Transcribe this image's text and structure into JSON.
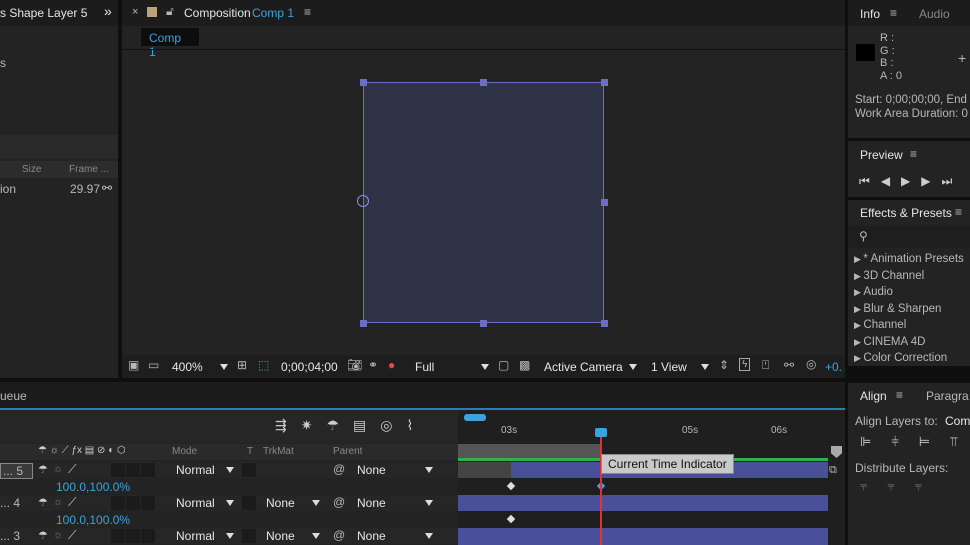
{
  "project_panel": {
    "title": "s Shape Layer 5",
    "more": "»",
    "item_label": "s",
    "columns": [
      "Size",
      "Frame ..."
    ],
    "row": {
      "name": "ion",
      "frame_rate": "29.97"
    }
  },
  "comp_panel": {
    "title_prefix": "Composition",
    "comp_name": "Comp 1",
    "tab": "Comp 1"
  },
  "viewer_toolbar": {
    "zoom": "400%",
    "timecode": "0;00;04;00",
    "resolution": "Full",
    "camera": "Active Camera",
    "views": "1 View",
    "exposure": "+0."
  },
  "info": {
    "tabs": [
      "Info",
      "Audio"
    ],
    "r": "R :",
    "g": "G :",
    "b": "B :",
    "a": "A : 0",
    "start": "Start: 0;00;00;00, End",
    "duration": "Work Area Duration: 0"
  },
  "preview": {
    "title": "Preview"
  },
  "effects": {
    "title": "Effects & Presets",
    "items": [
      "* Animation Presets",
      "3D Channel",
      "Audio",
      "Blur & Sharpen",
      "Channel",
      "CINEMA 4D",
      "Color Correction"
    ]
  },
  "align": {
    "tabs": [
      "Align",
      "Paragra"
    ],
    "align_to_label": "Align Layers to:",
    "align_to_value": "Com",
    "distribute_label": "Distribute Layers:"
  },
  "timeline": {
    "tab": "ueue",
    "columns": {
      "mode": "Mode",
      "t": "T",
      "trkmat": "TrkMat",
      "parent": "Parent"
    },
    "layers": [
      {
        "num": "... 5",
        "mode": "Normal",
        "trkmat": "",
        "parent": "None",
        "scale": "100.0,100.0%"
      },
      {
        "num": "... 4",
        "mode": "Normal",
        "trkmat": "None",
        "parent": "None",
        "scale": "100.0,100.0%"
      },
      {
        "num": "... 3",
        "mode": "Normal",
        "trkmat": "None",
        "parent": "None"
      }
    ],
    "ruler": [
      "03s",
      "05s",
      "06s"
    ],
    "tooltip": "Current Time Indicator"
  }
}
